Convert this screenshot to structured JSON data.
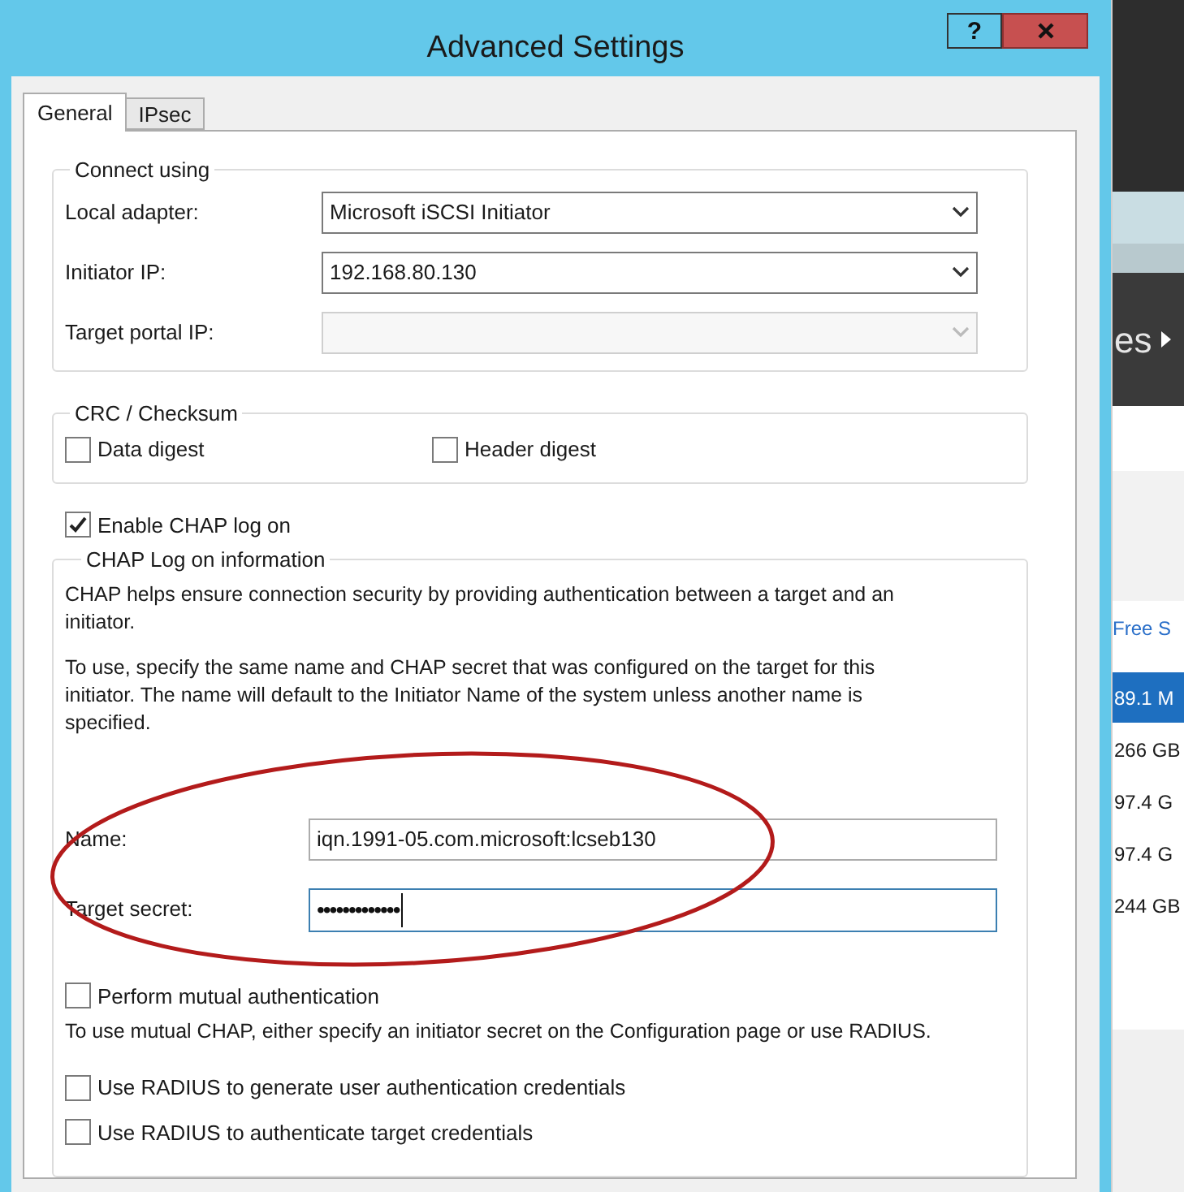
{
  "window": {
    "title": "Advanced Settings",
    "help_button": "?"
  },
  "tabs": [
    {
      "label": "General",
      "selected": true
    },
    {
      "label": "IPsec",
      "selected": false
    }
  ],
  "connect_using": {
    "title": "Connect using",
    "fields": [
      {
        "label": "Local adapter:",
        "value": "Microsoft iSCSI Initiator",
        "disabled": false
      },
      {
        "label": "Initiator IP:",
        "value": "192.168.80.130",
        "disabled": false
      },
      {
        "label": "Target portal IP:",
        "disabled": true
      }
    ]
  },
  "crc_checksum": {
    "title": "CRC / Checksum",
    "options": [
      {
        "label": "Data digest",
        "checked": false
      },
      {
        "label": "Header digest",
        "checked": false
      }
    ]
  },
  "enable_chap": {
    "label": "Enable CHAP log on",
    "checked": true
  },
  "chap_info": {
    "title": "CHAP Log on information",
    "description": "CHAP helps ensure connection security by providing authentication between a target and an initiator.",
    "instructions": "To use, specify the same name and CHAP secret that was configured on the target for this initiator.  The name will default to the Initiator Name of the system unless another name is specified.",
    "name": {
      "label": "Name:",
      "value": "iqn.1991-05.com.microsoft:lcseb130"
    },
    "target_secret": {
      "label": "Target secret:",
      "value": "•••••••••••••"
    },
    "mutual": {
      "label": "Perform mutual authentication",
      "checked": false
    },
    "mutual_note": "To use mutual CHAP, either specify an initiator secret on the Configuration page or use RADIUS.",
    "radius_options": [
      {
        "label": "Use RADIUS to generate user authentication credentials",
        "checked": false
      },
      {
        "label": "Use RADIUS to authenticate target credentials",
        "checked": false
      }
    ]
  },
  "background_window": {
    "heading": "es",
    "column_header": "Free S",
    "rows": [
      {
        "text": "89.1 M",
        "selected": true
      },
      {
        "text": "266 GB",
        "selected": false
      },
      {
        "text": "97.4 G",
        "selected": false
      },
      {
        "text": "97.4 G",
        "selected": false
      },
      {
        "text": "244 GB",
        "selected": false
      }
    ]
  }
}
